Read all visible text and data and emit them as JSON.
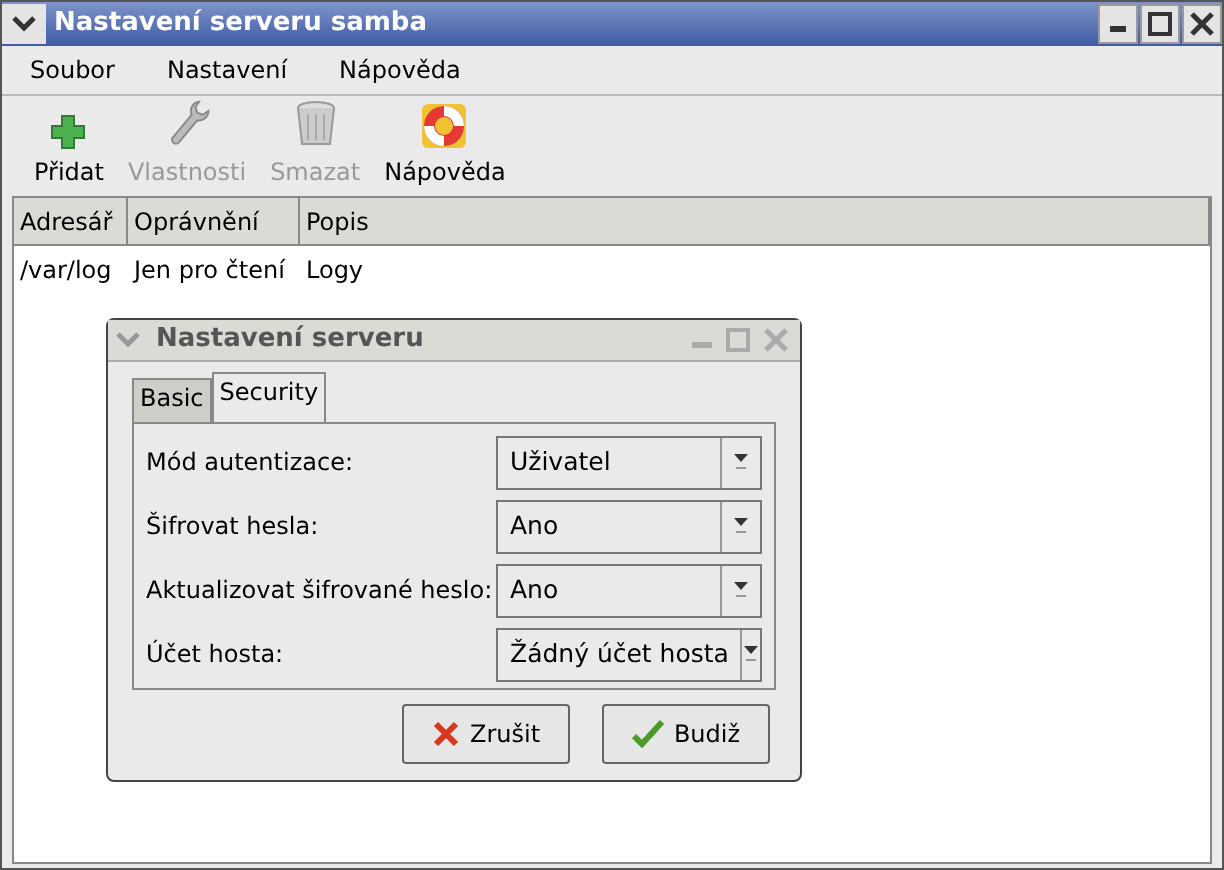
{
  "window": {
    "title": "Nastavení serveru samba"
  },
  "menu": [
    "Soubor",
    "Nastavení",
    "Nápověda"
  ],
  "toolbar": [
    {
      "kind": "add",
      "label": "Přidat",
      "disabled": false
    },
    {
      "kind": "wrench",
      "label": "Vlastnosti",
      "disabled": true
    },
    {
      "kind": "trash",
      "label": "Smazat",
      "disabled": true
    },
    {
      "kind": "help",
      "label": "Nápověda",
      "disabled": false
    }
  ],
  "table": {
    "columns": [
      "Adresář",
      "Oprávnění",
      "Popis"
    ],
    "rows": [
      [
        "/var/log",
        "Jen pro čtení",
        "Logy"
      ]
    ]
  },
  "dialog": {
    "title": "Nastavení serveru",
    "tabs": [
      {
        "label": "Basic",
        "selected": false
      },
      {
        "label": "Security",
        "selected": true
      }
    ],
    "fields": [
      {
        "label": "Mód autentizace:",
        "value": "Uživatel"
      },
      {
        "label": "Šifrovat hesla:",
        "value": "Ano"
      },
      {
        "label": "Aktualizovat šifrované heslo:",
        "value": "Ano"
      },
      {
        "label": "Účet hosta:",
        "value": "Žádný účet hosta"
      }
    ],
    "buttons": [
      {
        "kind": "cancel",
        "label": "Zrušit"
      },
      {
        "kind": "ok",
        "label": "Budiž"
      }
    ]
  }
}
